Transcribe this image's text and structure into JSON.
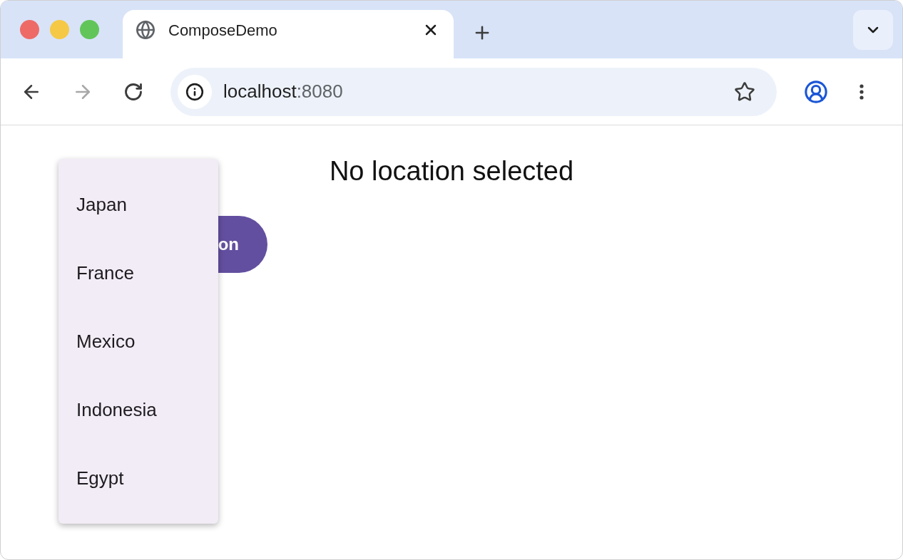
{
  "window": {
    "controls": [
      {
        "color": "#ee6a67"
      },
      {
        "color": "#f5c945"
      },
      {
        "color": "#62c55a"
      }
    ]
  },
  "tabs": [
    {
      "title": "ComposeDemo",
      "selected": true
    }
  ],
  "toolbar": {
    "forward_disabled": true,
    "url_host": "localhost",
    "url_port": ":8080"
  },
  "page": {
    "status": "No location selected",
    "button_label": "on"
  },
  "menu": {
    "items": [
      {
        "label": "Japan"
      },
      {
        "label": "France"
      },
      {
        "label": "Mexico"
      },
      {
        "label": "Indonesia"
      },
      {
        "label": "Egypt"
      }
    ]
  }
}
